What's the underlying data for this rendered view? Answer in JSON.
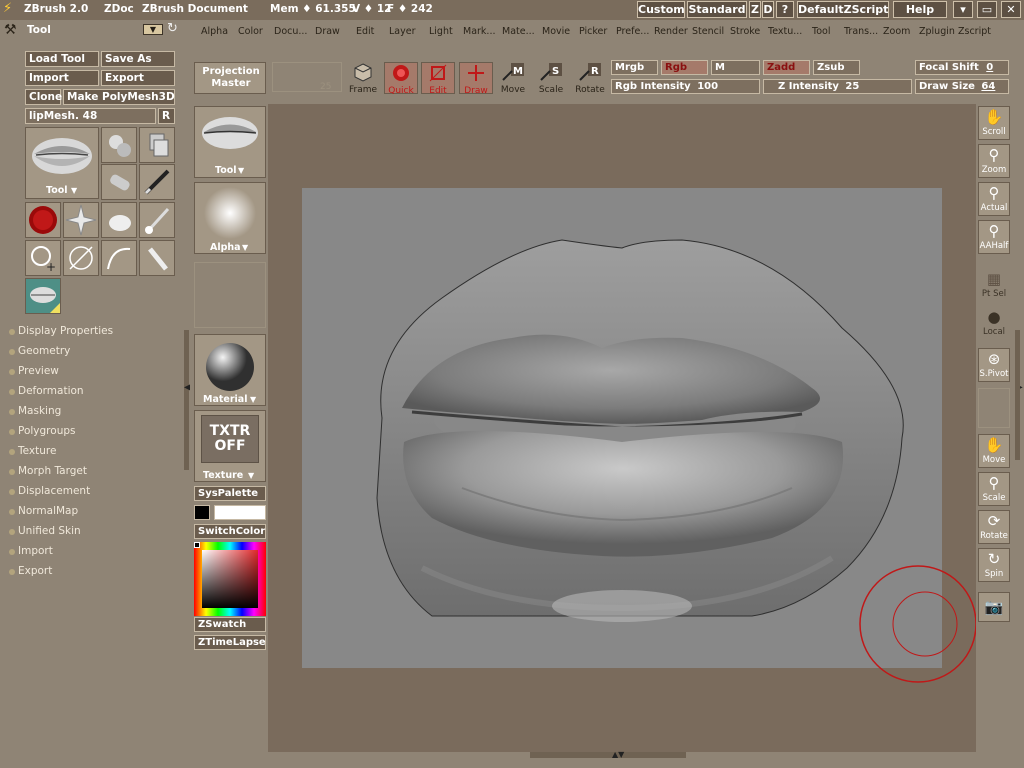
{
  "titlebar": {
    "app": "ZBrush 2.0",
    "doc": "ZDoc",
    "doc_name": "ZBrush Document",
    "mem": "Mem ♦ 61.355",
    "verts": "V ♦ 12",
    "faces": "F ♦ 242",
    "buttons": [
      "Custom",
      "Standard",
      "Z",
      "D",
      "?",
      "DefaultZScript",
      "Help"
    ]
  },
  "menubar": {
    "items": [
      "Alpha",
      "Color",
      "Docu...",
      "Draw",
      "Edit",
      "Layer",
      "Light",
      "Mark...",
      "Mate...",
      "Movie",
      "Picker",
      "Prefe...",
      "Render",
      "Stencil",
      "Stroke",
      "Textu...",
      "Tool",
      "Trans...",
      "Zoom",
      "Zplugin",
      "Zscript"
    ]
  },
  "tool_panel": {
    "title": "Tool",
    "load_tool": "Load Tool",
    "save_as": "Save As",
    "import": "Import",
    "export": "Export",
    "clone": "Clone",
    "make_polymesh": "Make PolyMesh3D",
    "current_mesh": "lipMesh. 48",
    "r_button": "R",
    "tool_label": "Tool"
  },
  "sections": [
    "Display Properties",
    "Geometry",
    "Preview",
    "Deformation",
    "Masking",
    "Polygroups",
    "Texture",
    "Morph Target",
    "Displacement",
    "NormalMap",
    "Unified Skin",
    "Import",
    "Export"
  ],
  "middle": {
    "projection_master": "Projection Master",
    "tool": "Tool",
    "alpha": "Alpha",
    "material": "Material",
    "texture": "Texture",
    "txtr_line1": "TXTR",
    "txtr_line2": "OFF",
    "syspalette": "SysPalette",
    "switchcolor": "SwitchColor",
    "zswatch": "ZSwatch",
    "ztimelapse": "ZTimeLapse"
  },
  "top_toolbar": {
    "frame": "Frame",
    "quick": "Quick",
    "edit": "Edit",
    "draw": "Draw",
    "move": "Move",
    "scale": "Scale",
    "rotate": "Rotate",
    "mrgb": "Mrgb",
    "rgb": "Rgb",
    "m": "M",
    "zadd": "Zadd",
    "zsub": "Zsub",
    "focal_shift_label": "Focal Shift",
    "focal_shift_value": "0",
    "rgb_intensity_label": "Rgb Intensity",
    "rgb_intensity_value": "100",
    "z_intensity_label": "Z Intensity",
    "z_intensity_value": "25",
    "draw_size_label": "Draw Size",
    "draw_size_value": "64",
    "dim_value": "25"
  },
  "right_column": {
    "scroll": "Scroll",
    "zoom": "Zoom",
    "actual": "Actual",
    "aahalf": "AAHalf",
    "ptsel": "Pt Sel",
    "local": "Local",
    "spivot": "S.Pivot",
    "move": "Move",
    "scale": "Scale",
    "rotate": "Rotate",
    "spin": "Spin"
  },
  "colors": {
    "accent_red": "#c01818",
    "panel": "#8f8475",
    "button": "#6a5c4d"
  }
}
